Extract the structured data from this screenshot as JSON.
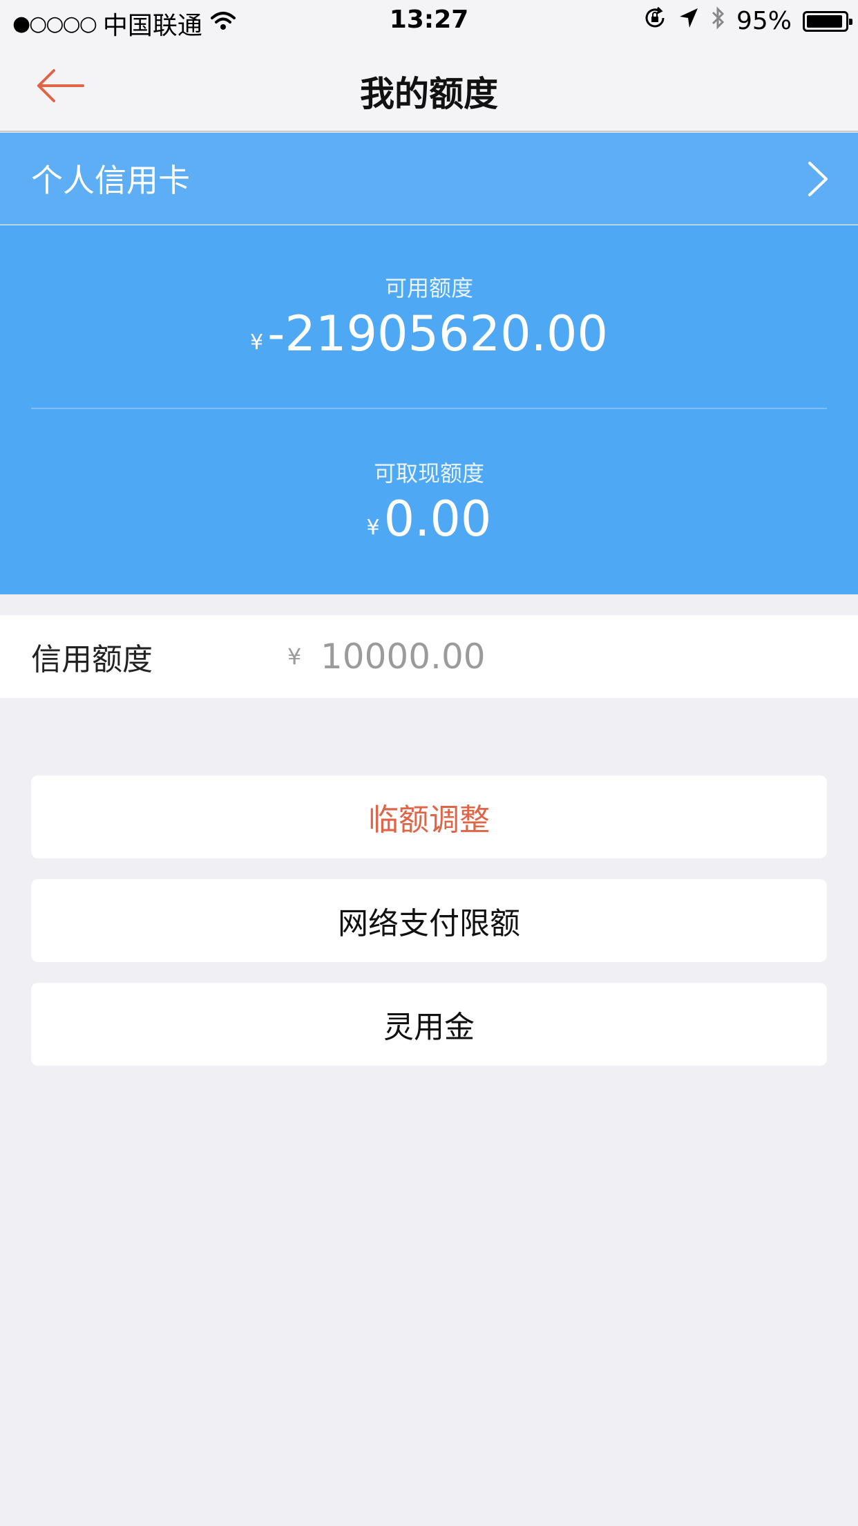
{
  "status_bar": {
    "signal": "●○○○○",
    "carrier": "中国联通",
    "time": "13:27",
    "battery": "95%",
    "battery_level": 0.95
  },
  "nav": {
    "title": "我的额度",
    "back_icon": "back-arrow-icon"
  },
  "card": {
    "name": "个人信用卡"
  },
  "available": {
    "label": "可用额度",
    "currency": "¥",
    "value": "-21905620.00"
  },
  "cash": {
    "label": "可取现额度",
    "currency": "¥",
    "value": "0.00"
  },
  "credit": {
    "label": "信用额度",
    "currency": "¥",
    "value": "10000.00"
  },
  "actions": [
    {
      "label": "临额调整"
    },
    {
      "label": "网络支付限额"
    },
    {
      "label": "灵用金"
    }
  ],
  "colors": {
    "accent": "#e06446",
    "header_blue": "#5daef4",
    "panel_blue": "#4ea8f3",
    "background": "#efeff4"
  }
}
